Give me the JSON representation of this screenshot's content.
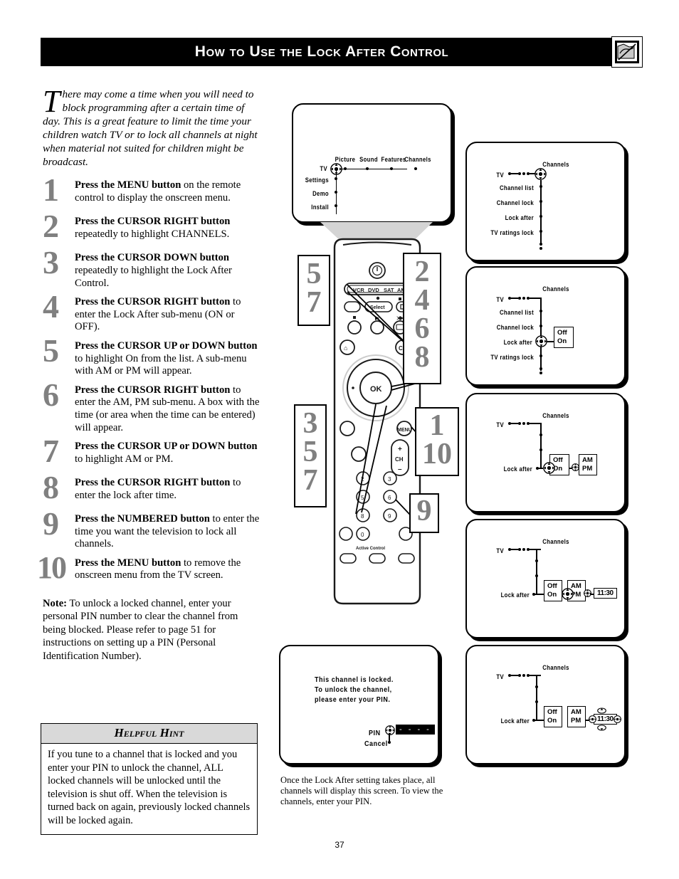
{
  "header": {
    "title": "How to Use the Lock After Control",
    "icon": "blocked-tv-hand-icon"
  },
  "intro": {
    "dropcap": "T",
    "text": "here may come a time when you will need to block programming after a certain time of day. This is a great feature to limit the time your children watch TV or to lock all channels at night when material not suited for children might be broadcast."
  },
  "steps": [
    {
      "num": "1",
      "html": "<b>Press the MENU button</b> on the remote control to display the onscreen menu."
    },
    {
      "num": "2",
      "html": "<b>Press the CURSOR RIGHT button</b> repeatedly to highlight CHANNELS."
    },
    {
      "num": "3",
      "html": "<b>Press the CURSOR DOWN button</b> repeatedly to highlight the Lock After Control."
    },
    {
      "num": "4",
      "html": "<b>Press the CURSOR RIGHT button</b> to enter the Lock After sub-menu (ON or OFF)."
    },
    {
      "num": "5",
      "html": "<b>Press the CURSOR UP or DOWN button</b> to highlight On from the list. A sub-menu with AM or PM will appear."
    },
    {
      "num": "6",
      "html": "<b>Press the CURSOR RIGHT button</b> to enter the AM, PM sub-menu. A box with the time (or area when the time can be entered) will appear."
    },
    {
      "num": "7",
      "html": "<b>Press the CURSOR UP or DOWN button</b> to highlight AM or PM."
    },
    {
      "num": "8",
      "html": "<b>Press the CURSOR RIGHT button</b> to enter the lock after time."
    },
    {
      "num": "9",
      "html": "<b>Press the NUMBERED button</b> to enter the time you want the television to lock all channels."
    },
    {
      "num": "10",
      "html": "<b>Press the MENU button</b> to remove the onscreen menu from the TV screen."
    }
  ],
  "note": {
    "label": "Note:",
    "text": " To unlock a locked channel, enter your personal PIN number to clear the channel from being blocked. Please refer to page 51 for instructions on setting up a PIN (Personal Identification Number)."
  },
  "hint": {
    "title": "Helpful Hint",
    "body": "If you tune to a channel that is locked and you enter your PIN to unlock the channel, ALL locked channels will be unlocked until the television is shut off. When the television is turned back on again, previously locked channels will be locked again."
  },
  "caption": "Once the Lock After setting takes place, all channels will display this screen. To view the channels, enter your PIN.",
  "page_number": "37",
  "screens": {
    "main_menu": {
      "root": "TV",
      "top_items": [
        "Picture",
        "Sound",
        "Features",
        "Channels"
      ],
      "left_items": [
        "Settings",
        "Demo",
        "Install"
      ],
      "cursor_on": "TV"
    },
    "channels_menu": {
      "title": "Channels",
      "root": "TV",
      "items": [
        "Channel list",
        "Channel lock",
        "Lock after",
        "TV ratings lock"
      ],
      "cursor_on": "Channels"
    },
    "lock_after_onoff": {
      "title": "Channels",
      "root": "TV",
      "items": [
        "Channel list",
        "Channel lock",
        "Lock after",
        "TV ratings lock"
      ],
      "cursor_on": "Lock after",
      "options": [
        "Off",
        "On"
      ]
    },
    "ampm_menu": {
      "title": "Channels",
      "root": "TV",
      "label": "Lock after",
      "options": [
        "Off",
        "On"
      ],
      "selected_option": "On",
      "ampm": [
        "AM",
        "PM"
      ]
    },
    "time_menu": {
      "title": "Channels",
      "root": "TV",
      "label": "Lock after",
      "options": [
        "Off",
        "On"
      ],
      "ampm": [
        "AM",
        "PM"
      ],
      "selected_ampm": "PM",
      "time": "11:30"
    },
    "time_entry": {
      "title": "Channels",
      "root": "TV",
      "label": "Lock after",
      "options": [
        "Off",
        "On"
      ],
      "ampm": [
        "AM",
        "PM"
      ],
      "time": "11:30"
    },
    "pin_screen": {
      "line1": "This channel is locked.",
      "line2": "To unlock the channel,",
      "line3": "please enter your PIN.",
      "pin_label": "PIN",
      "cancel_label": "Cancel",
      "pin_value": "- - - -"
    }
  },
  "remote": {
    "mode_buttons": [
      "VCR",
      "DVD",
      "SAT",
      "AMP"
    ],
    "select_label": "Select",
    "ch_label": "CH",
    "ch_plus": "+",
    "ch_minus": "–",
    "ok_label": "OK",
    "menu_label": "MENU",
    "cc_label": "CC",
    "active_control_label": "Active Control",
    "number_keys": [
      "2",
      "3",
      "5",
      "6",
      "8",
      "9",
      "0"
    ],
    "callouts": [
      {
        "name": "cursor-up-callout",
        "lines": [
          "5",
          "7"
        ]
      },
      {
        "name": "cursor-right-callout",
        "lines": [
          "2",
          "4",
          "6",
          "8"
        ]
      },
      {
        "name": "cursor-down-callout",
        "lines": [
          "3",
          "5",
          "7"
        ]
      },
      {
        "name": "menu-callout",
        "lines": [
          "1",
          "10"
        ]
      },
      {
        "name": "numbered-callout",
        "lines": [
          "9"
        ]
      }
    ]
  },
  "colors": {
    "step_number_gray": "#808080",
    "hint_header_gray": "#d9d9d9",
    "black": "#000000"
  }
}
